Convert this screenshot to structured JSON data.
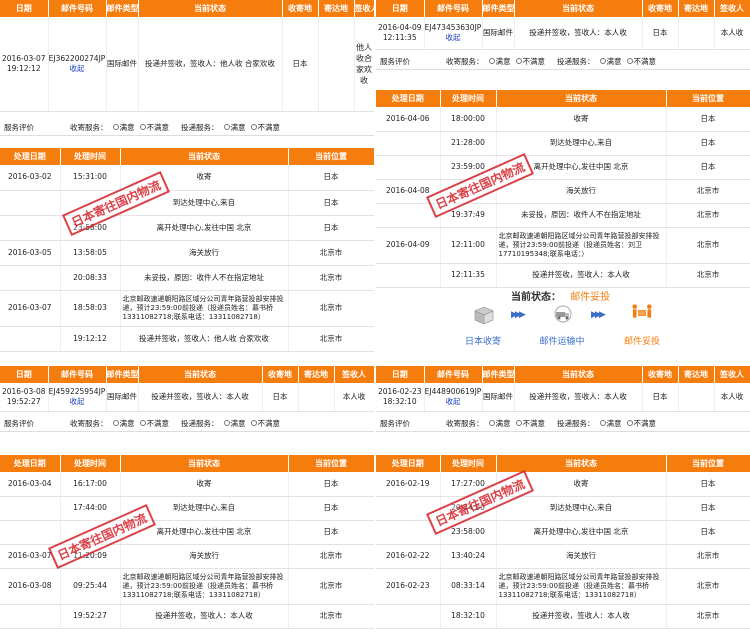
{
  "mail_header": [
    "日期",
    "邮件号码",
    "邮件类型",
    "当前状态",
    "收寄地",
    "寄达地",
    "签收人"
  ],
  "track_header": [
    "处理日期",
    "处理时间",
    "当前状态",
    "当前位置"
  ],
  "eval": {
    "label": "服务评价",
    "collect": "收寄服务：",
    "deliver": "投递服务：",
    "ok": "满意",
    "bad": "不满意"
  },
  "stamp": "日本寄往国内物流",
  "panels": {
    "tl": {
      "mail": {
        "date": "2016-03-07 19:12:12",
        "num": "EJ362200274JP",
        "action": "收起",
        "type": "国际邮件",
        "status": "投递并签收，签收人：他人收 合家欢收",
        "from": "日本",
        "to": "",
        "signer": "他人收合家欢收"
      },
      "rows": [
        {
          "d": "2016-03-02",
          "t": "15:31:00",
          "s": "收寄",
          "p": "日本"
        },
        {
          "d": "",
          "t": "",
          "s": "到达处理中心,来自",
          "p": "日本"
        },
        {
          "d": "",
          "t": "23:58:00",
          "s": "离开处理中心,发往中国 北京",
          "p": "日本"
        },
        {
          "d": "2016-03-05",
          "t": "13:58:05",
          "s": "海关放行",
          "p": "北京市"
        },
        {
          "d": "",
          "t": "20:08:33",
          "s": "未妥投，原因：收件人不在指定地址",
          "p": "北京市"
        },
        {
          "d": "2016-03-07",
          "t": "18:58:03",
          "s": "北京邮政速递朝阳路区域分公司青年路营投部安排投递，预计23:59:00前投递（投递员姓名：慕书桥13311082718;联系电话：13311082718）",
          "p": "北京市"
        },
        {
          "d": "",
          "t": "19:12:12",
          "s": "投递并签收，签收人：他人收 合家欢收",
          "p": "北京市"
        }
      ]
    },
    "tr": {
      "mail": {
        "date": "2016-04-09 12:11:35",
        "num": "EJ473453630JP",
        "action": "收起",
        "type": "国际邮件",
        "status": "投递并签收，签收人：本人收",
        "from": "日本",
        "to": "",
        "signer": "本人收"
      },
      "rows": [
        {
          "d": "2016-04-06",
          "t": "18:00:00",
          "s": "收寄",
          "p": "日本"
        },
        {
          "d": "",
          "t": "21:28:00",
          "s": "到达处理中心,来自",
          "p": "日本"
        },
        {
          "d": "",
          "t": "23:59:00",
          "s": "离开处理中心,发往中国 北京",
          "p": "日本"
        },
        {
          "d": "2016-04-08",
          "t": "",
          "s": "海关放行",
          "p": "北京市"
        },
        {
          "d": "",
          "t": "19:37:49",
          "s": "未妥投，原因：收件人不在指定地址",
          "p": "北京市"
        },
        {
          "d": "2016-04-09",
          "t": "12:11:00",
          "s": "北京邮政速递朝阳路区域分公司青年路营投部安排投递，预计23:59:00前投递（投递员姓名：刘卫17710195348;联系电话：）",
          "p": "北京市"
        },
        {
          "d": "",
          "t": "12:11:35",
          "s": "投递并签收，签收人：本人收",
          "p": "北京市"
        }
      ],
      "current": {
        "label": "当前状态：",
        "value": "邮件妥投",
        "steps": [
          "日本收寄",
          "邮件运输中",
          "邮件妥投"
        ]
      }
    },
    "bl": {
      "mail": {
        "date": "2016-03-08 19:52:27",
        "num": "EJ459225954JP",
        "action": "收起",
        "type": "国际邮件",
        "status": "投递并签收，签收人：本人收",
        "from": "日本",
        "to": "",
        "signer": "本人收"
      },
      "rows": [
        {
          "d": "2016-03-04",
          "t": "16:17:00",
          "s": "收寄",
          "p": "日本"
        },
        {
          "d": "",
          "t": "17:44:00",
          "s": "到达处理中心,来自",
          "p": "日本"
        },
        {
          "d": "",
          "t": "",
          "s": "离开处理中心,发往中国 北京",
          "p": "日本"
        },
        {
          "d": "2016-03-07",
          "t": "11:20:09",
          "s": "海关放行",
          "p": "北京市"
        },
        {
          "d": "2016-03-08",
          "t": "09:25:44",
          "s": "北京邮政速递朝阳路区域分公司青年路营投部安排投递，预计23:59:00前投递（投递员姓名：慕书桥13311082718;联系电话：13311082718）",
          "p": "北京市"
        },
        {
          "d": "",
          "t": "19:52:27",
          "s": "投递并签收，签收人：本人收",
          "p": "北京市"
        }
      ]
    },
    "br": {
      "mail": {
        "date": "2016-02-23 18:32:10",
        "num": "EJ448900619JP",
        "action": "收起",
        "type": "国际邮件",
        "status": "投递并签收，签收人：本人收",
        "from": "日本",
        "to": "",
        "signer": "本人收"
      },
      "rows": [
        {
          "d": "2016-02-19",
          "t": "17:27:00",
          "s": "收寄",
          "p": "日本"
        },
        {
          "d": "",
          "t": "20:24:00",
          "s": "到达处理中心,来自",
          "p": "日本"
        },
        {
          "d": "",
          "t": "23:58:00",
          "s": "离开处理中心,发往中国 北京",
          "p": "日本"
        },
        {
          "d": "2016-02-22",
          "t": "13:40:24",
          "s": "海关放行",
          "p": "北京市"
        },
        {
          "d": "2016-02-23",
          "t": "08:33:14",
          "s": "北京邮政速递朝阳路区域分公司青年路营投部安排投递，预计23:59:00前投递（投递员姓名：慕书桥13311082718;联系电话：13311082718）",
          "p": "北京市"
        },
        {
          "d": "",
          "t": "18:32:10",
          "s": "投递并签收，签收人：本人收",
          "p": "北京市"
        }
      ]
    }
  },
  "colors": {
    "header": "#f47d0e",
    "link": "#1a3fbf",
    "stamp": "#d4232a",
    "current": "#f47d0e"
  }
}
